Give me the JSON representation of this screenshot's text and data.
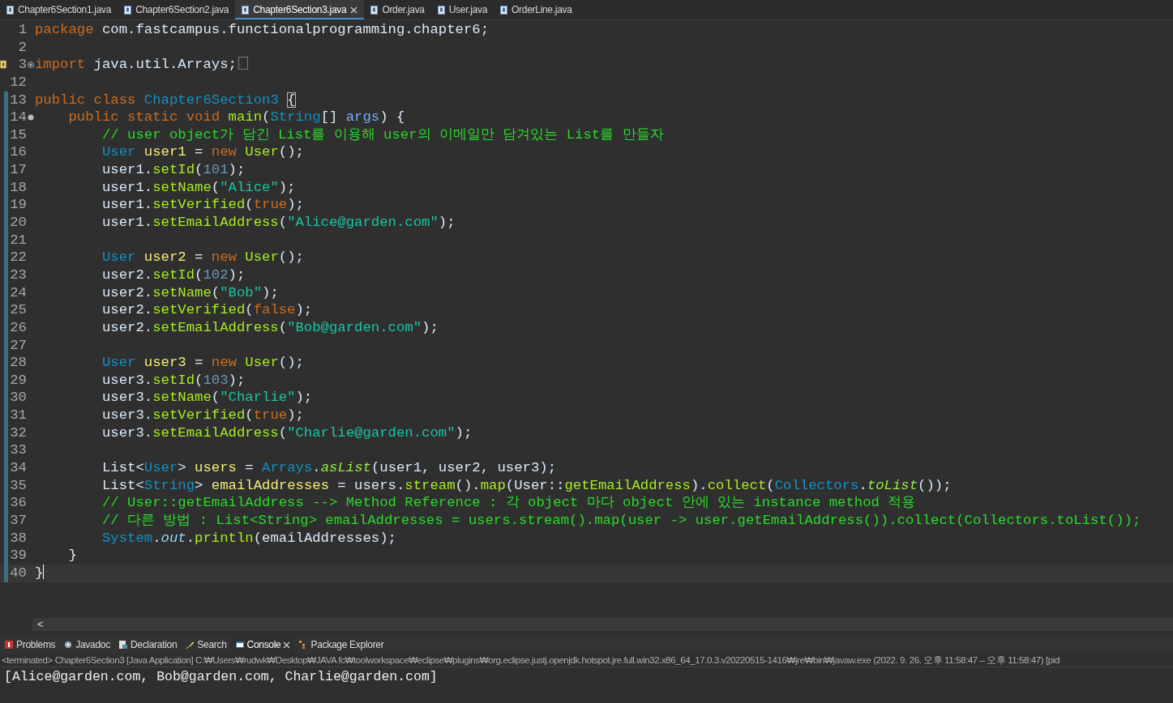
{
  "editor_tabs": [
    {
      "label": "Chapter6Section1.java",
      "selected": false,
      "closable": false
    },
    {
      "label": "Chapter6Section2.java",
      "selected": false,
      "closable": false
    },
    {
      "label": "Chapter6Section3.java",
      "selected": true,
      "closable": true
    },
    {
      "label": "Order.java",
      "selected": false,
      "closable": false
    },
    {
      "label": "User.java",
      "selected": false,
      "closable": false
    },
    {
      "label": "OrderLine.java",
      "selected": false,
      "closable": false
    }
  ],
  "code_lines": [
    {
      "number": "1",
      "in_scope": false,
      "current": false,
      "tokens": [
        {
          "kind": "kw",
          "text": "package"
        },
        {
          "kind": "plain",
          "text": " com.fastcampus.functionalprogramming.chapter6;"
        }
      ]
    },
    {
      "number": "2",
      "in_scope": false,
      "current": false
    },
    {
      "number": "3",
      "in_scope": false,
      "current": false,
      "folded": true,
      "quickfix": true,
      "tokens": [
        {
          "kind": "kw",
          "text": "import"
        },
        {
          "kind": "plain",
          "text": " java.util.Arrays;"
        }
      ]
    },
    {
      "number": "12",
      "in_scope": false,
      "current": false
    },
    {
      "number": "13",
      "in_scope": true,
      "current": false,
      "tokens": [
        {
          "kind": "kw",
          "text": "public class "
        },
        {
          "kind": "type",
          "text": "Chapter6Section3 "
        },
        {
          "kind": "match",
          "text": "{"
        }
      ]
    },
    {
      "number": "14",
      "in_scope": true,
      "current": false,
      "folded": false,
      "tokens": [
        {
          "kind": "kw",
          "text": "    public static void "
        },
        {
          "kind": "meth",
          "text": "main"
        },
        {
          "kind": "plain",
          "text": "("
        },
        {
          "kind": "type",
          "text": "String"
        },
        {
          "kind": "plain",
          "text": "[] "
        },
        {
          "kind": "param",
          "text": "args"
        },
        {
          "kind": "plain",
          "text": ") {"
        }
      ]
    },
    {
      "number": "15",
      "in_scope": true,
      "current": false,
      "tokens": [
        {
          "kind": "com",
          "text": "        // user object가 담긴 List를 이용해 user의 이메일만 담겨있는 List를 만들자"
        }
      ]
    },
    {
      "number": "16",
      "in_scope": true,
      "current": false,
      "tokens": [
        {
          "kind": "type",
          "text": "        User "
        },
        {
          "kind": "decl",
          "text": "user1"
        },
        {
          "kind": "plain",
          "text": " = "
        },
        {
          "kind": "kw",
          "text": "new "
        },
        {
          "kind": "meth",
          "text": "User"
        },
        {
          "kind": "plain",
          "text": "();"
        }
      ]
    },
    {
      "number": "17",
      "in_scope": true,
      "current": false,
      "tokens": [
        {
          "kind": "plain",
          "text": "        user1."
        },
        {
          "kind": "meth",
          "text": "setId"
        },
        {
          "kind": "plain",
          "text": "("
        },
        {
          "kind": "num",
          "text": "101"
        },
        {
          "kind": "plain",
          "text": ");"
        }
      ]
    },
    {
      "number": "18",
      "in_scope": true,
      "current": false,
      "tokens": [
        {
          "kind": "plain",
          "text": "        user1."
        },
        {
          "kind": "meth",
          "text": "setName"
        },
        {
          "kind": "plain",
          "text": "("
        },
        {
          "kind": "str",
          "text": "\"Alice\""
        },
        {
          "kind": "plain",
          "text": ");"
        }
      ]
    },
    {
      "number": "19",
      "in_scope": true,
      "current": false,
      "tokens": [
        {
          "kind": "plain",
          "text": "        user1."
        },
        {
          "kind": "meth",
          "text": "setVerified"
        },
        {
          "kind": "plain",
          "text": "("
        },
        {
          "kind": "kw",
          "text": "true"
        },
        {
          "kind": "plain",
          "text": ");"
        }
      ]
    },
    {
      "number": "20",
      "in_scope": true,
      "current": false,
      "tokens": [
        {
          "kind": "plain",
          "text": "        user1."
        },
        {
          "kind": "meth",
          "text": "setEmailAddress"
        },
        {
          "kind": "plain",
          "text": "("
        },
        {
          "kind": "str",
          "text": "\"Alice@garden.com\""
        },
        {
          "kind": "plain",
          "text": ");"
        }
      ]
    },
    {
      "number": "21",
      "in_scope": true,
      "current": false
    },
    {
      "number": "22",
      "in_scope": true,
      "current": false,
      "tokens": [
        {
          "kind": "type",
          "text": "        User "
        },
        {
          "kind": "decl",
          "text": "user2"
        },
        {
          "kind": "plain",
          "text": " = "
        },
        {
          "kind": "kw",
          "text": "new "
        },
        {
          "kind": "meth",
          "text": "User"
        },
        {
          "kind": "plain",
          "text": "();"
        }
      ]
    },
    {
      "number": "23",
      "in_scope": true,
      "current": false,
      "tokens": [
        {
          "kind": "plain",
          "text": "        user2."
        },
        {
          "kind": "meth",
          "text": "setId"
        },
        {
          "kind": "plain",
          "text": "("
        },
        {
          "kind": "num",
          "text": "102"
        },
        {
          "kind": "plain",
          "text": ");"
        }
      ]
    },
    {
      "number": "24",
      "in_scope": true,
      "current": false,
      "tokens": [
        {
          "kind": "plain",
          "text": "        user2."
        },
        {
          "kind": "meth",
          "text": "setName"
        },
        {
          "kind": "plain",
          "text": "("
        },
        {
          "kind": "str",
          "text": "\"Bob\""
        },
        {
          "kind": "plain",
          "text": ");"
        }
      ]
    },
    {
      "number": "25",
      "in_scope": true,
      "current": false,
      "tokens": [
        {
          "kind": "plain",
          "text": "        user2."
        },
        {
          "kind": "meth",
          "text": "setVerified"
        },
        {
          "kind": "plain",
          "text": "("
        },
        {
          "kind": "kw",
          "text": "false"
        },
        {
          "kind": "plain",
          "text": ");"
        }
      ]
    },
    {
      "number": "26",
      "in_scope": true,
      "current": false,
      "tokens": [
        {
          "kind": "plain",
          "text": "        user2."
        },
        {
          "kind": "meth",
          "text": "setEmailAddress"
        },
        {
          "kind": "plain",
          "text": "("
        },
        {
          "kind": "str",
          "text": "\"Bob@garden.com\""
        },
        {
          "kind": "plain",
          "text": ");"
        }
      ]
    },
    {
      "number": "27",
      "in_scope": true,
      "current": false
    },
    {
      "number": "28",
      "in_scope": true,
      "current": false,
      "tokens": [
        {
          "kind": "type",
          "text": "        User "
        },
        {
          "kind": "decl",
          "text": "user3"
        },
        {
          "kind": "plain",
          "text": " = "
        },
        {
          "kind": "kw",
          "text": "new "
        },
        {
          "kind": "meth",
          "text": "User"
        },
        {
          "kind": "plain",
          "text": "();"
        }
      ]
    },
    {
      "number": "29",
      "in_scope": true,
      "current": false,
      "tokens": [
        {
          "kind": "plain",
          "text": "        user3."
        },
        {
          "kind": "meth",
          "text": "setId"
        },
        {
          "kind": "plain",
          "text": "("
        },
        {
          "kind": "num",
          "text": "103"
        },
        {
          "kind": "plain",
          "text": ");"
        }
      ]
    },
    {
      "number": "30",
      "in_scope": true,
      "current": false,
      "tokens": [
        {
          "kind": "plain",
          "text": "        user3."
        },
        {
          "kind": "meth",
          "text": "setName"
        },
        {
          "kind": "plain",
          "text": "("
        },
        {
          "kind": "str",
          "text": "\"Charlie\""
        },
        {
          "kind": "plain",
          "text": ");"
        }
      ]
    },
    {
      "number": "31",
      "in_scope": true,
      "current": false,
      "tokens": [
        {
          "kind": "plain",
          "text": "        user3."
        },
        {
          "kind": "meth",
          "text": "setVerified"
        },
        {
          "kind": "plain",
          "text": "("
        },
        {
          "kind": "kw",
          "text": "true"
        },
        {
          "kind": "plain",
          "text": ");"
        }
      ]
    },
    {
      "number": "32",
      "in_scope": true,
      "current": false,
      "tokens": [
        {
          "kind": "plain",
          "text": "        user3."
        },
        {
          "kind": "meth",
          "text": "setEmailAddress"
        },
        {
          "kind": "plain",
          "text": "("
        },
        {
          "kind": "str",
          "text": "\"Charlie@garden.com\""
        },
        {
          "kind": "plain",
          "text": ");"
        }
      ]
    },
    {
      "number": "33",
      "in_scope": true,
      "current": false
    },
    {
      "number": "34",
      "in_scope": true,
      "current": false,
      "tokens": [
        {
          "kind": "plain",
          "text": "        List<"
        },
        {
          "kind": "type",
          "text": "User"
        },
        {
          "kind": "plain",
          "text": "> "
        },
        {
          "kind": "decl",
          "text": "users"
        },
        {
          "kind": "plain",
          "text": " = "
        },
        {
          "kind": "type",
          "text": "Arrays"
        },
        {
          "kind": "plain",
          "text": "."
        },
        {
          "kind": "smeth",
          "text": "asList"
        },
        {
          "kind": "plain",
          "text": "(user1, user2, user3);"
        }
      ]
    },
    {
      "number": "35",
      "in_scope": true,
      "current": false,
      "tokens": [
        {
          "kind": "plain",
          "text": "        List<"
        },
        {
          "kind": "type",
          "text": "String"
        },
        {
          "kind": "plain",
          "text": "> "
        },
        {
          "kind": "decl",
          "text": "emailAddresses"
        },
        {
          "kind": "plain",
          "text": " = users."
        },
        {
          "kind": "meth",
          "text": "stream"
        },
        {
          "kind": "plain",
          "text": "()."
        },
        {
          "kind": "meth",
          "text": "map"
        },
        {
          "kind": "plain",
          "text": "(User::"
        },
        {
          "kind": "meth",
          "text": "getEmailAddress"
        },
        {
          "kind": "plain",
          "text": ")."
        },
        {
          "kind": "meth",
          "text": "collect"
        },
        {
          "kind": "plain",
          "text": "("
        },
        {
          "kind": "type",
          "text": "Collectors"
        },
        {
          "kind": "plain",
          "text": "."
        },
        {
          "kind": "smeth",
          "text": "toList"
        },
        {
          "kind": "plain",
          "text": "());"
        }
      ]
    },
    {
      "number": "36",
      "in_scope": true,
      "current": false,
      "tokens": [
        {
          "kind": "com",
          "text": "        // User::getEmailAddress --> Method Reference : 각 object 마다 object 안에 있는 instance method 적용"
        }
      ]
    },
    {
      "number": "37",
      "in_scope": true,
      "current": false,
      "tokens": [
        {
          "kind": "com",
          "text": "        // 다른 방법 : List<String> emailAddresses = users.stream().map(user -> user.getEmailAddress()).collect(Collectors.toList());"
        }
      ]
    },
    {
      "number": "38",
      "in_scope": true,
      "current": false,
      "tokens": [
        {
          "kind": "type",
          "text": "        System"
        },
        {
          "kind": "plain",
          "text": "."
        },
        {
          "kind": "field",
          "text": "out"
        },
        {
          "kind": "plain",
          "text": "."
        },
        {
          "kind": "meth",
          "text": "println"
        },
        {
          "kind": "plain",
          "text": "(emailAddresses);"
        }
      ]
    },
    {
      "number": "39",
      "in_scope": true,
      "current": false,
      "tokens": [
        {
          "kind": "plain",
          "text": "    }"
        }
      ]
    },
    {
      "number": "40",
      "in_scope": true,
      "current": true,
      "tokens": [
        {
          "kind": "plain",
          "text": "}"
        }
      ]
    }
  ],
  "scroll_left": "<",
  "console": {
    "tabs": [
      {
        "label": "Problems",
        "selected": false,
        "closable": false
      },
      {
        "label": "Javadoc",
        "selected": false,
        "closable": false
      },
      {
        "label": "Declaration",
        "selected": false,
        "closable": false
      },
      {
        "label": "Search",
        "selected": false,
        "closable": false
      },
      {
        "label": "Console",
        "selected": true,
        "closable": true
      },
      {
        "label": "Package Explorer",
        "selected": false,
        "closable": false
      }
    ],
    "status": "<terminated> Chapter6Section3 [Java Application] C:₩Users₩rudwk₩Desktop₩JAVA fc₩toolworkspace₩eclipse₩plugins₩org.eclipse.justj.openjdk.hotspot.jre.full.win32.x86_64_17.0.3.v20220515-1416₩jre₩bin₩javaw.exe  (2022. 9. 26. 오후 11:58:47 – 오후 11:58:47) [pid",
    "output": "[Alice@garden.com, Bob@garden.com, Charlie@garden.com]"
  }
}
